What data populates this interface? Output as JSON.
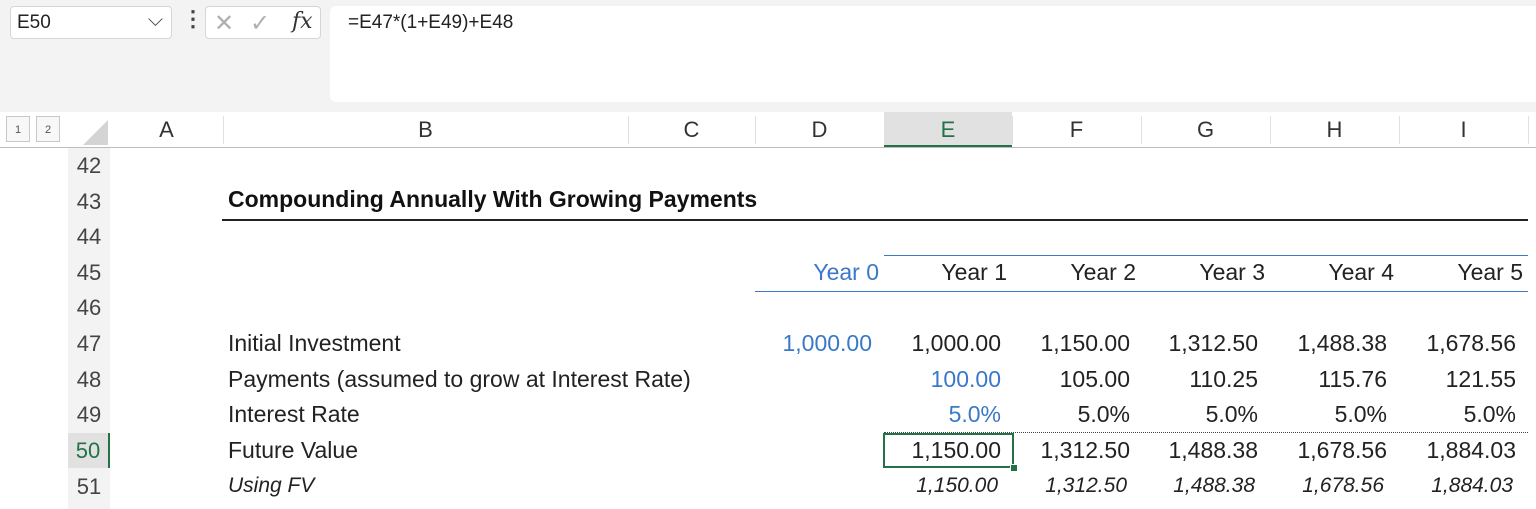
{
  "formula_bar": {
    "name_box": "E50",
    "formula": "=E47*(1+E49)+E48",
    "cancel_glyph": "✕",
    "enter_glyph": "✓",
    "fx_label": "fx"
  },
  "outline_levels": [
    "1",
    "2"
  ],
  "columns": [
    "A",
    "B",
    "C",
    "D",
    "E",
    "F",
    "G",
    "H",
    "I"
  ],
  "selected_column": "E",
  "rows": [
    "42",
    "43",
    "44",
    "45",
    "46",
    "47",
    "48",
    "49",
    "50",
    "51"
  ],
  "selected_row": "50",
  "sheet": {
    "title": "Compounding Annually With Growing Payments",
    "years": [
      "Year  0",
      "Year  1",
      "Year  2",
      "Year  3",
      "Year  4",
      "Year  5"
    ],
    "initial_investment": {
      "label": "Initial Investment",
      "values": [
        "1,000.00",
        "1,000.00",
        "1,150.00",
        "1,312.50",
        "1,488.38",
        "1,678.56"
      ]
    },
    "payments": {
      "label": "Payments (assumed to grow at Interest Rate)",
      "values": [
        "100.00",
        "105.00",
        "110.25",
        "115.76",
        "121.55"
      ]
    },
    "interest_rate": {
      "label": "Interest Rate",
      "values": [
        "5.0%",
        "5.0%",
        "5.0%",
        "5.0%",
        "5.0%"
      ]
    },
    "future_value": {
      "label": "Future Value",
      "values": [
        "1,150.00",
        "1,312.50",
        "1,488.38",
        "1,678.56",
        "1,884.03"
      ]
    },
    "using_fv": {
      "label": "Using FV",
      "values": [
        "1,150.00",
        "1,312.50",
        "1,488.38",
        "1,678.56",
        "1,884.03"
      ]
    }
  },
  "colors": {
    "input_blue": "#3b78c9",
    "selection_green": "#217346"
  }
}
